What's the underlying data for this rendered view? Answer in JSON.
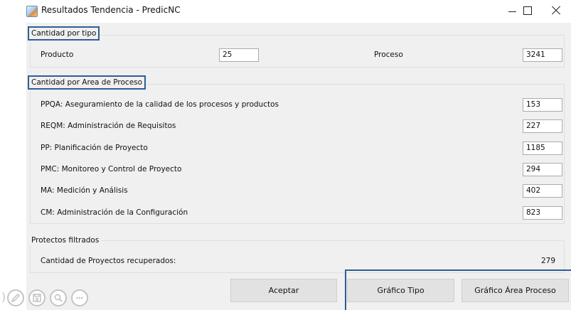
{
  "window": {
    "title": "Resultados Tendencia - PredicNC"
  },
  "cantidad_por_tipo": {
    "title": "Cantidad por tipo",
    "producto_label": "Producto",
    "producto_value": "25",
    "proceso_label": "Proceso",
    "proceso_value": "3241"
  },
  "cantidad_por_area": {
    "title": "Cantidad por Area de Proceso",
    "rows": [
      {
        "label": "PPQA: Aseguramiento de la calidad de los procesos y productos",
        "value": "153"
      },
      {
        "label": "REQM: Administración de Requisitos",
        "value": "227"
      },
      {
        "label": "PP: Planificación de Proyecto",
        "value": "1185"
      },
      {
        "label": "PMC: Monitoreo y Control de Proyecto",
        "value": "294"
      },
      {
        "label": "MA: Medición y Análisis",
        "value": "402"
      },
      {
        "label": "CM: Administración de la Configuración",
        "value": "823"
      }
    ]
  },
  "proyectos_filtrados": {
    "title": "Protectos filtrados",
    "label": "Cantidad de Proyectos recuperados:",
    "value": "279"
  },
  "buttons": {
    "aceptar": "Aceptar",
    "grafico_tipo": "Gráfico Tipo",
    "grafico_area": "Gráfico Área Proceso"
  },
  "toolbar": {
    "paren": ")",
    "icons": [
      "pencil-icon",
      "save-icon",
      "search-icon",
      "more-icon"
    ]
  },
  "colors": {
    "panel_bg": "#f0f0f0",
    "highlight_border": "#2c5f95",
    "button_bg": "#e2e2e2"
  }
}
